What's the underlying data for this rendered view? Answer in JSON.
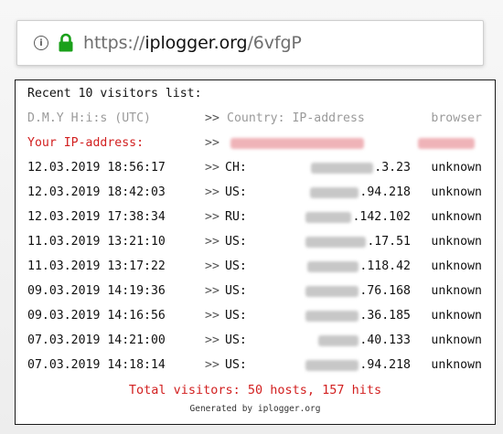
{
  "address_bar": {
    "scheme": "https://",
    "host": "iplogger.org",
    "path": "/6vfgP",
    "icons": [
      "info-icon",
      "lock-icon"
    ],
    "lock_color": "#1aa01a"
  },
  "logger": {
    "title": "Recent 10 visitors list:",
    "headers": {
      "datetime": "D.M.Y H:i:s (UTC)",
      "arrow": ">>",
      "country_ip": "Country: IP-address",
      "browser": "browser"
    },
    "your_ip": {
      "label": "Your IP-address:",
      "arrow": ">>"
    },
    "visitors": [
      {
        "datetime": "12.03.2019 18:56:17",
        "country": "CH:",
        "ip_tail": ".3.23",
        "browser": "unknown"
      },
      {
        "datetime": "12.03.2019 18:42:03",
        "country": "US:",
        "ip_tail": ".94.218",
        "browser": "unknown"
      },
      {
        "datetime": "12.03.2019 17:38:34",
        "country": "RU:",
        "ip_tail": ".142.102",
        "browser": "unknown"
      },
      {
        "datetime": "11.03.2019 13:21:10",
        "country": "US:",
        "ip_tail": ".17.51",
        "browser": "unknown"
      },
      {
        "datetime": "11.03.2019 13:17:22",
        "country": "US:",
        "ip_tail": ".118.42",
        "browser": "unknown"
      },
      {
        "datetime": "09.03.2019 14:19:36",
        "country": "US:",
        "ip_tail": ".76.168",
        "browser": "unknown"
      },
      {
        "datetime": "09.03.2019 14:16:56",
        "country": "US:",
        "ip_tail": ".36.185",
        "browser": "unknown"
      },
      {
        "datetime": "07.03.2019 14:21:00",
        "country": "US:",
        "ip_tail": ".40.133",
        "browser": "unknown"
      },
      {
        "datetime": "07.03.2019 14:18:14",
        "country": "US:",
        "ip_tail": ".94.218",
        "browser": "unknown"
      }
    ],
    "arrow": ">>",
    "total": "Total visitors: 50 hosts, 157 hits",
    "generated": "Generated by iplogger.org",
    "colors": {
      "red": "#d21f1f",
      "header_gray": "#9a9a9a"
    }
  }
}
